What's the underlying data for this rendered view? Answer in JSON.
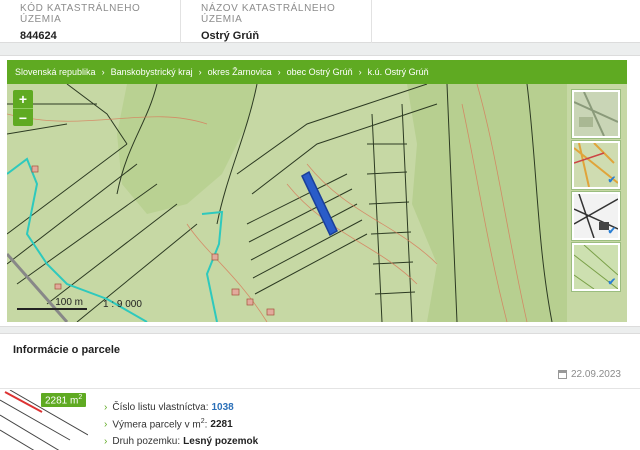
{
  "header_fields": [
    {
      "label": "KÓD KATASTRÁLNEHO ÚZEMIA",
      "value": "844624"
    },
    {
      "label": "NÁZOV KATASTRÁLNEHO ÚZEMIA",
      "value": "Ostrý Grúň"
    }
  ],
  "breadcrumb": [
    "Slovenská republika",
    "Banskobystrický kraj",
    "okres Žarnovica",
    "obec Ostrý Grúň",
    "k.ú. Ostrý Grúň"
  ],
  "map": {
    "zoom_in": "+",
    "zoom_out": "−",
    "scale_label": "100 m",
    "scale_ratio": "1 : 9 000",
    "layers": [
      "orthophoto-layer",
      "cadastral-map-layer",
      "vector-map-layer",
      "parcel-map-layer"
    ]
  },
  "info": {
    "title": "Informácie o parcele",
    "date": "22.09.2023",
    "area_badge": "2281 m",
    "area_badge_unit": "2",
    "props": [
      {
        "label": "Číslo listu vlastníctva:",
        "value": "1038"
      },
      {
        "label": "Výmera parcely v m",
        "sup": "2",
        "label_end": ":",
        "value": "2281"
      },
      {
        "label": "Druh pozemku:",
        "value": "Lesný pozemok"
      }
    ]
  },
  "colors": {
    "brand_green": "#5faa22",
    "link_blue": "#2a6fb8",
    "parcel_highlight": "#2a5cc9"
  }
}
